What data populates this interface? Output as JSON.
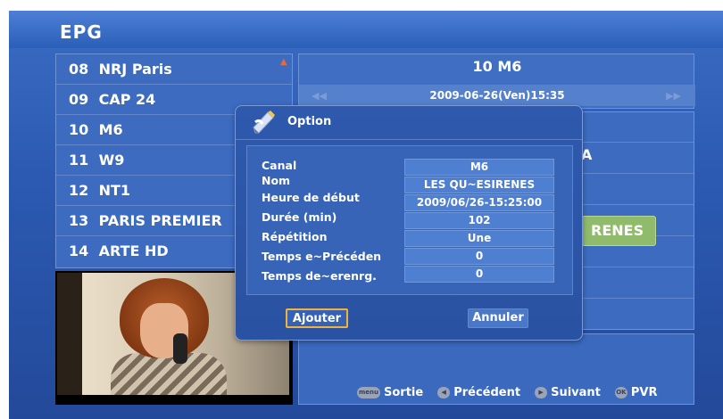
{
  "header": {
    "title": "EPG"
  },
  "channels": [
    {
      "num": "08",
      "name": "NRJ Paris"
    },
    {
      "num": "09",
      "name": "CAP 24"
    },
    {
      "num": "10",
      "name": "M6"
    },
    {
      "num": "11",
      "name": "W9"
    },
    {
      "num": "12",
      "name": "NT1"
    },
    {
      "num": "13",
      "name": "PARIS PREMIER"
    },
    {
      "num": "14",
      "name": "ARTE HD"
    }
  ],
  "program": {
    "channel": "10   M6",
    "date": "2009-06-26(Ven)15:35",
    "highlighted_fragment": "RENES",
    "peek_fragment": "A"
  },
  "dialog": {
    "title": "Option",
    "fields": [
      {
        "label": "Canal",
        "value": "M6"
      },
      {
        "label": "Nom",
        "value": "LES QU~ESIRENES"
      },
      {
        "label": "Heure de début",
        "value": "2009/06/26-15:25:00"
      },
      {
        "label": "Durée (min)",
        "value": "102"
      },
      {
        "label": "Répétition",
        "value": "Une"
      },
      {
        "label": "Temps e~Précéden",
        "value": "0"
      },
      {
        "label": "Temps de~erenrg.",
        "value": "0"
      }
    ],
    "add_label": "Ajouter",
    "cancel_label": "Annuler"
  },
  "footer": {
    "menu_key": "menu",
    "exit_label": "Sortie",
    "prev_label": "Précédent",
    "next_label": "Suivant",
    "ok_key": "OK",
    "pvr_label": "PVR"
  },
  "icons": {
    "scroll": "scroll-arrow-icon",
    "dialog": "pencil-option-icon",
    "prev": "rewind-icon",
    "next": "fast-forward-icon"
  },
  "colors": {
    "background": "#2c5ab2",
    "highlight": "#8fbb6a",
    "focus_border": "#f0b23a"
  }
}
